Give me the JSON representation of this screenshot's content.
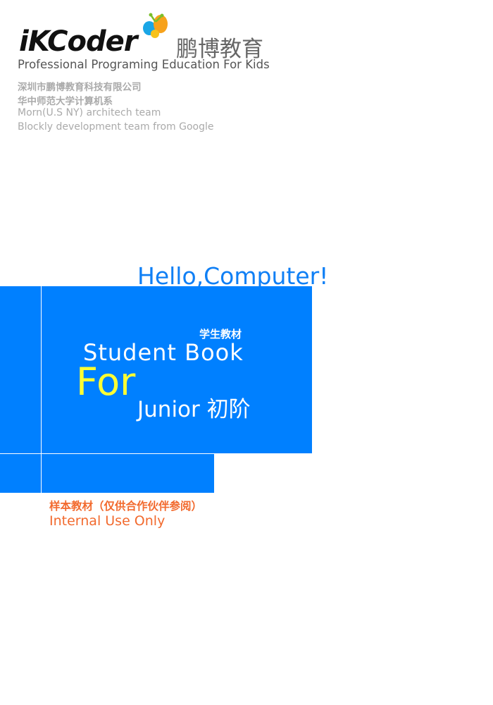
{
  "brand": {
    "logo_text": "iKCoder",
    "logo_icon": "butterfly-icon",
    "chinese_name": "鹏博教育",
    "tagline": "Professional Programing Education For Kids"
  },
  "info_lines": [
    "深圳市鹏博教育科技有限公司",
    "华中师范大学计算机系",
    "Morn(U.S NY) architech team",
    "Blockly development team from Google"
  ],
  "cover": {
    "hello": "Hello,Computer!",
    "label_cn": "学生教材",
    "student_book": "Student Book",
    "for": "For",
    "junior": "Junior  初阶"
  },
  "notice": {
    "sample_cn": "样本教材（仅供合作伙伴参阅）",
    "internal": "Internal Use Only"
  },
  "colors": {
    "blue": "#0080ff",
    "hello_blue": "#0f7ff5",
    "yellow": "#ffff33",
    "orange": "#f26a2e"
  }
}
